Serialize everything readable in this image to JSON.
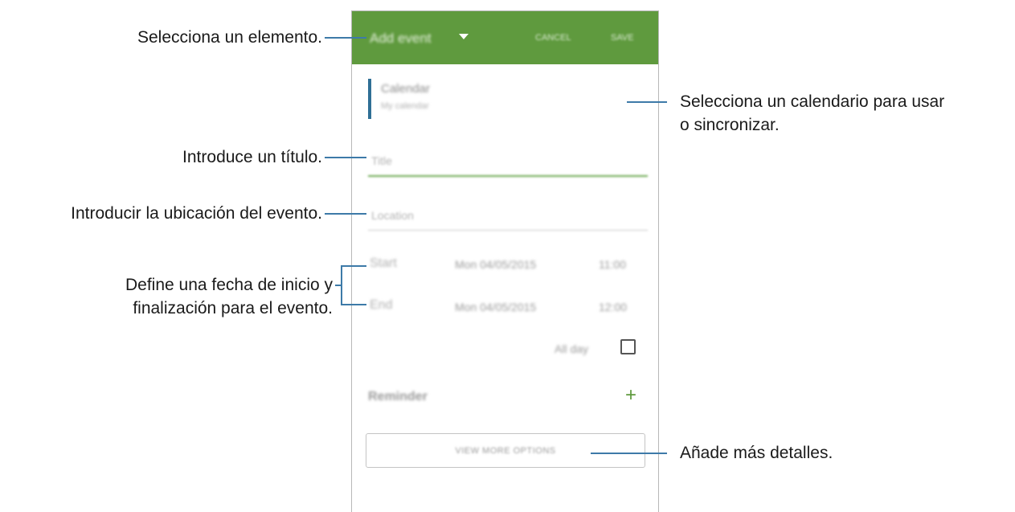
{
  "app_bar": {
    "title": "Add event",
    "cancel_label": "CANCEL",
    "save_label": "SAVE"
  },
  "calendar": {
    "label": "Calendar",
    "sub": "My calendar"
  },
  "title_field": {
    "placeholder": "Title"
  },
  "location_field": {
    "placeholder": "Location"
  },
  "start": {
    "label": "Start",
    "date": "Mon 04/05/2015",
    "time": "11:00"
  },
  "end": {
    "label": "End",
    "date": "Mon 04/05/2015",
    "time": "12:00"
  },
  "all_day": {
    "label": "All day",
    "checked": false
  },
  "reminder": {
    "label": "Reminder",
    "add_symbol": "+"
  },
  "more_options_label": "VIEW MORE OPTIONS",
  "callouts": {
    "select_item": "Selecciona un elemento.",
    "select_calendar_line1": "Selecciona un calendario para usar",
    "select_calendar_line2": "o sincronizar.",
    "enter_title": "Introduce un título.",
    "enter_location": "Introducir la ubicación del evento.",
    "define_dates_line1": "Define una fecha de inicio y",
    "define_dates_line2": "finalización para el evento.",
    "add_details": "Añade más detalles."
  },
  "colors": {
    "app_bar": "#5f9a3e",
    "accent_line": "#6aa84f",
    "callout_line": "#3d7aa8",
    "calendar_marker": "#2f6f95"
  }
}
